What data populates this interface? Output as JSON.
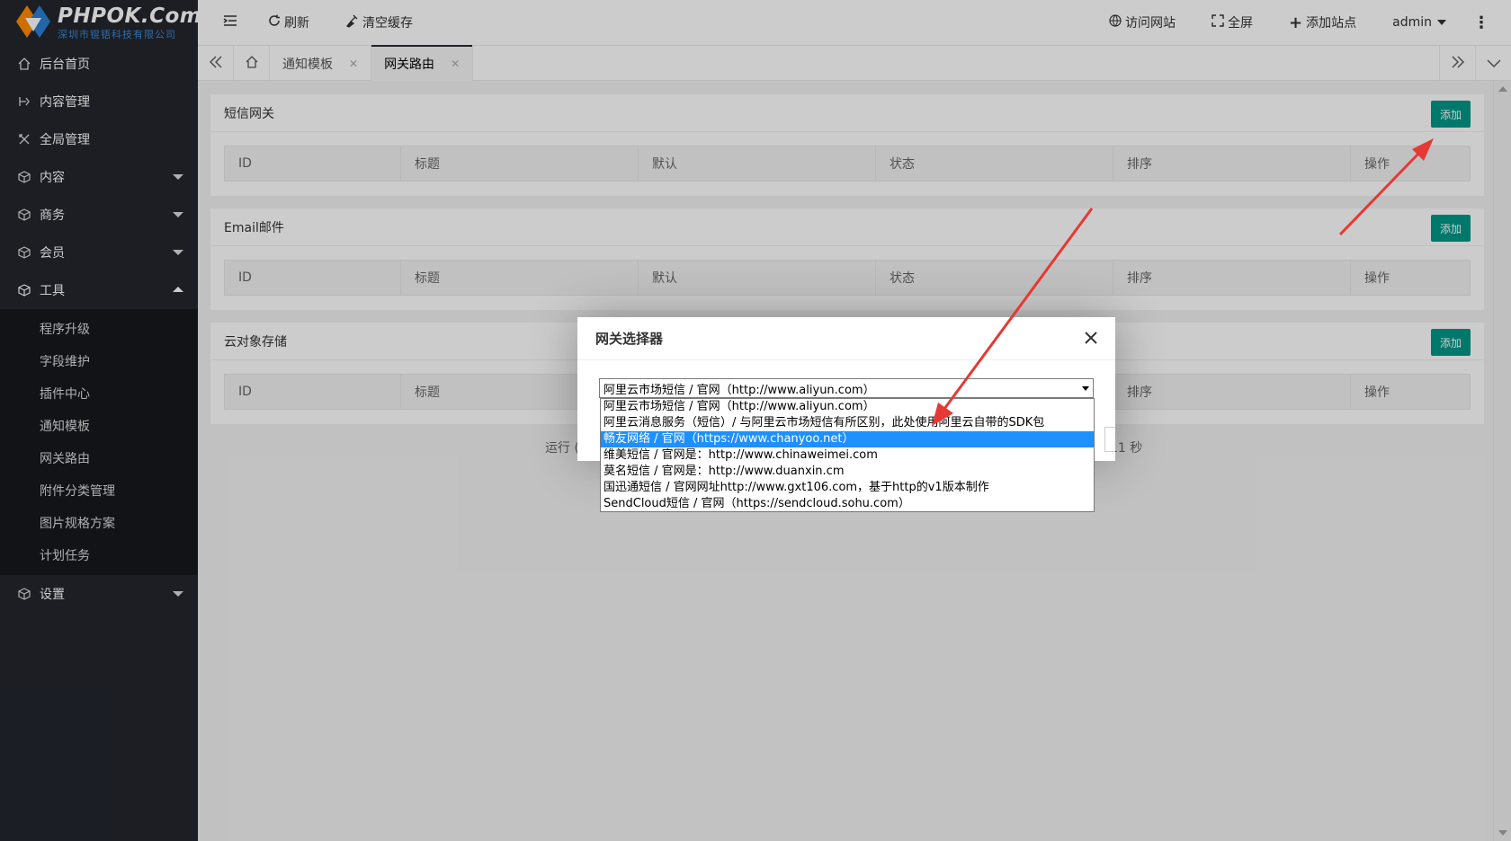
{
  "brand": {
    "title": "PHPOK.Com",
    "subtitle": "深圳市锟铻科技有限公司"
  },
  "sidebar": {
    "items": [
      {
        "label": "后台首页",
        "icon": "home-icon"
      },
      {
        "label": "内容管理",
        "icon": "content-manage-icon"
      },
      {
        "label": "全局管理",
        "icon": "global-icon"
      },
      {
        "label": "内容",
        "icon": "cube-icon"
      },
      {
        "label": "商务",
        "icon": "cube-icon"
      },
      {
        "label": "会员",
        "icon": "cube-icon"
      },
      {
        "label": "工具",
        "icon": "cube-icon"
      }
    ],
    "tools_submenu": [
      "程序升级",
      "字段维护",
      "插件中心",
      "通知模板",
      "网关路由",
      "附件分类管理",
      "图片规格方案",
      "计划任务"
    ],
    "settings": {
      "label": "设置",
      "icon": "cube-icon"
    }
  },
  "header": {
    "refresh": "刷新",
    "clear_cache": "清空缓存",
    "visit_site": "访问网站",
    "fullscreen": "全屏",
    "add_site": "添加站点",
    "user": "admin"
  },
  "tabs": [
    {
      "label": "通知模板",
      "active": false
    },
    {
      "label": "网关路由",
      "active": true
    }
  ],
  "tables": {
    "columns": [
      "ID",
      "标题",
      "默认",
      "状态",
      "排序",
      "操作"
    ],
    "sms": {
      "title": "短信网关",
      "add": "添加"
    },
    "email": {
      "title": "Email邮件",
      "add": "添加"
    },
    "cloud": {
      "title": "云对象存储",
      "add": "添加"
    }
  },
  "footer": {
    "left": "运行 (",
    "right": "11 秒"
  },
  "modal": {
    "title": "网关选择器",
    "selected": "阿里云市场短信 / 官网（http://www.aliyun.com）",
    "options": [
      "阿里云市场短信 / 官网（http://www.aliyun.com）",
      "阿里云消息服务（短信）/ 与阿里云市场短信有所区别，此处使用阿里云自带的SDK包",
      "畅友网络 / 官网（https://www.chanyoo.net）",
      "维美短信 / 官网是：http://www.chinaweimei.com",
      "莫名短信 / 官网是：http://www.duanxin.cm",
      "国迅通短信 / 官网网址http://www.gxt106.com，基于http的v1版本制作",
      "SendCloud短信 / 官网（https://sendcloud.sohu.com）"
    ],
    "highlighted_index": 2
  },
  "colors": {
    "sidebar_bg": "#23262e",
    "accent": "#009688",
    "annotation": "#e53935"
  }
}
